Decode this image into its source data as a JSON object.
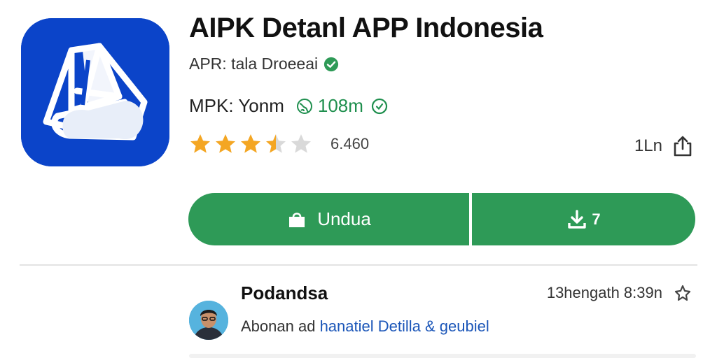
{
  "app": {
    "title": "AIPK Detanl APP Indonesia",
    "developer": "APR: tala Droeeai",
    "meta_label": "MPK: Yonm",
    "size": "108m",
    "rating_value": "6.460",
    "rating_stars": 3.5,
    "share_count": "1Ln",
    "icons": {
      "app_logo": "app-logo-icon",
      "verified": "check-circle-icon",
      "size": "globe-icon",
      "size_status": "check-circle-outline-icon",
      "share": "share-icon"
    }
  },
  "actions": {
    "install_label": "Undua",
    "download_label": "7",
    "icons": {
      "install": "shopping-bag-icon",
      "download": "download-icon"
    },
    "accent_color": "#2e9a57"
  },
  "review": {
    "reviewer": "Podandsa",
    "time": "13hengath 8:39n",
    "text_prefix": "Abonan ad",
    "text_link": "hanatiel Detilla & geubiel",
    "icons": {
      "avatar": "avatar",
      "bookmark": "bookmark-icon"
    }
  },
  "colors": {
    "brand_blue": "#0b44c9",
    "green": "#2e9a57",
    "star": "#f4a623",
    "link": "#1a55b8"
  }
}
